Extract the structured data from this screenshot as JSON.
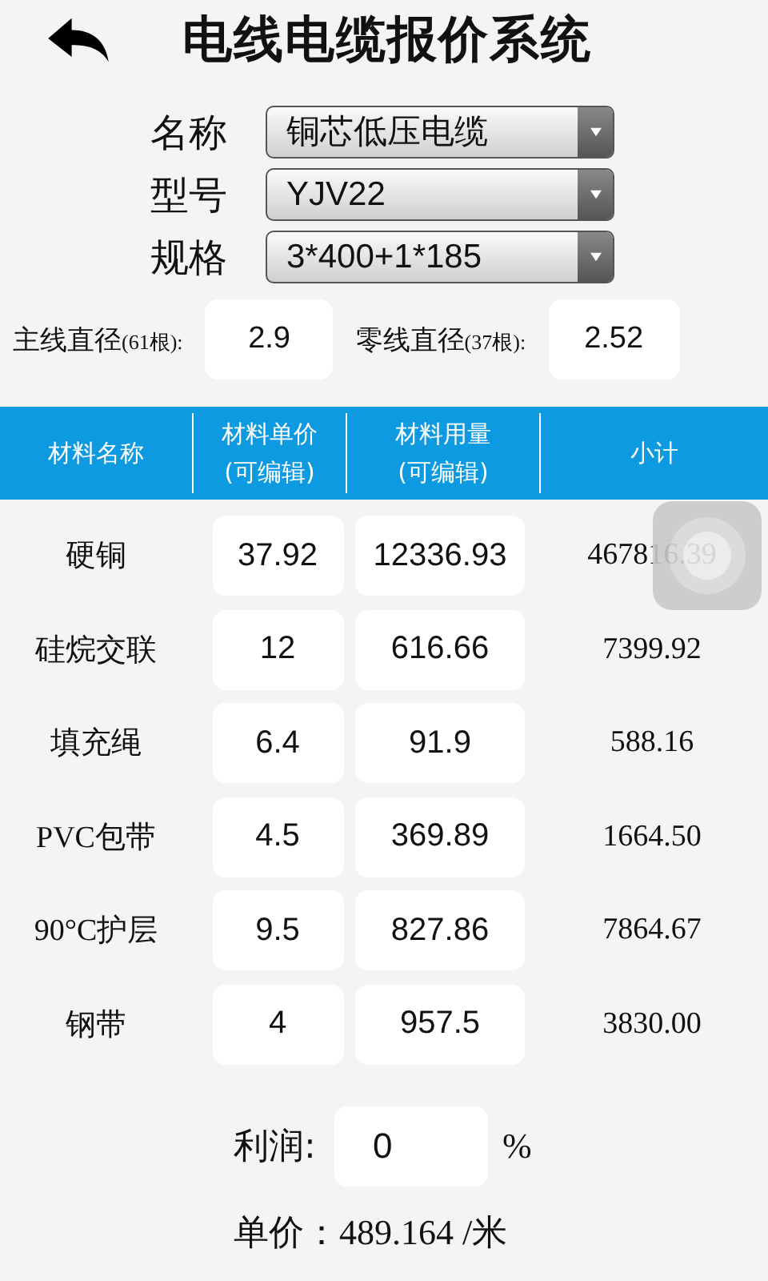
{
  "header": {
    "title": "电线电缆报价系统"
  },
  "selects": [
    {
      "label": "名称",
      "value": "铜芯低压电缆"
    },
    {
      "label": "型号",
      "value": "YJV22"
    },
    {
      "label": "规格",
      "value": "3*400+1*185"
    }
  ],
  "diameters": [
    {
      "label": "主线直径",
      "note": "(61根):",
      "value": "2.9"
    },
    {
      "label": "零线直径",
      "note": "(37根):",
      "value": "2.52"
    }
  ],
  "table": {
    "columns": [
      [
        "材料名称"
      ],
      [
        "材料单价",
        "(可编辑)"
      ],
      [
        "材料用量",
        "(可编辑)"
      ],
      [
        "小计"
      ]
    ],
    "rows": [
      {
        "name": "硬铜",
        "price": "37.92",
        "amount": "12336.93",
        "subtotal": "467816.39"
      },
      {
        "name": "硅烷交联",
        "price": "12",
        "amount": "616.66",
        "subtotal": "7399.92"
      },
      {
        "name": "填充绳",
        "price": "6.4",
        "amount": "91.9",
        "subtotal": "588.16"
      },
      {
        "name": "PVC包带",
        "price": "4.5",
        "amount": "369.89",
        "subtotal": "1664.50"
      },
      {
        "name": "90°C护层",
        "price": "9.5",
        "amount": "827.86",
        "subtotal": "7864.67"
      },
      {
        "name": "钢带",
        "price": "4",
        "amount": "957.5",
        "subtotal": "3830.00"
      }
    ]
  },
  "profit": {
    "label": "利润:",
    "value": "0",
    "unit": "%"
  },
  "unit_price": {
    "label": "单价：",
    "value": "489.164 /米"
  }
}
